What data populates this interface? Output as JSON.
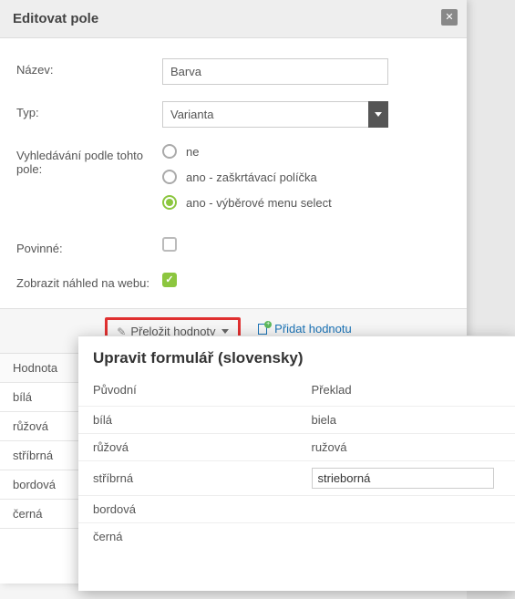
{
  "dialog": {
    "title": "Editovat pole"
  },
  "form": {
    "name_label": "Název:",
    "name_value": "Barva",
    "type_label": "Typ:",
    "type_value": "Varianta",
    "search_label": "Vyhledávání podle tohto pole:",
    "search_options": {
      "no": "ne",
      "yes_check": "ano - zaškrtávací políčka",
      "yes_select": "ano - výběrové menu select"
    },
    "search_selected": "yes_select",
    "required_label": "Povinné:",
    "required_checked": false,
    "preview_label": "Zobrazit náhled na webu:",
    "preview_checked": true
  },
  "toolbar": {
    "translate_label": "Přeložit hodnoty",
    "add_label": "Přidat hodnotu"
  },
  "values": {
    "header": "Hodnota",
    "items": [
      "bílá",
      "růžová",
      "stříbrná",
      "bordová",
      "černá"
    ]
  },
  "translate_modal": {
    "title": "Upravit formulář (slovensky)",
    "col_original": "Původní",
    "col_translation": "Překlad",
    "rows": [
      {
        "orig": "bílá",
        "trans": "biela"
      },
      {
        "orig": "růžová",
        "trans": "ružová"
      },
      {
        "orig": "stříbrná",
        "trans": "strieborná",
        "editing": true
      },
      {
        "orig": "bordová",
        "trans": ""
      },
      {
        "orig": "černá",
        "trans": ""
      }
    ]
  }
}
